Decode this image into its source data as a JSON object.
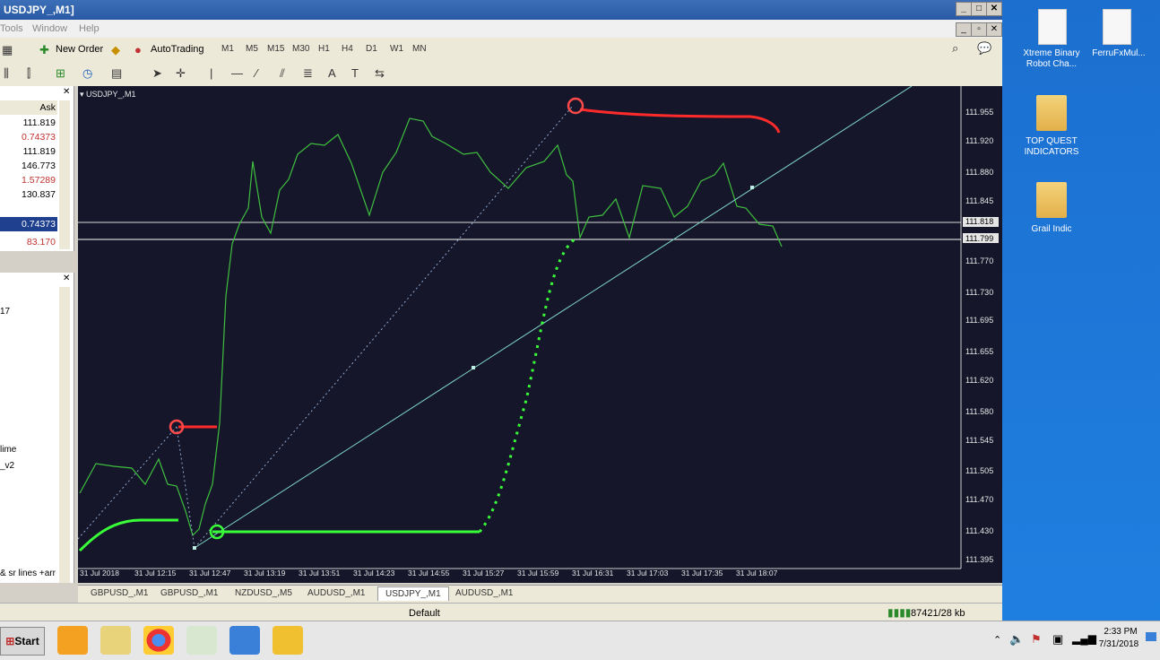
{
  "window": {
    "title": "USDJPY_,M1]"
  },
  "menu": {
    "tools": "Tools",
    "window": "Window",
    "help": "Help"
  },
  "toolbar": {
    "new_order": "New Order",
    "autotrading": "AutoTrading",
    "timeframes": [
      "M1",
      "M5",
      "M15",
      "M30",
      "H1",
      "H4",
      "D1",
      "W1",
      "MN"
    ]
  },
  "market_watch": {
    "ask_header": "Ask",
    "values": [
      "111.819",
      "0.74373",
      "111.819",
      "146.773",
      "1.57289",
      "130.837",
      "0.74373",
      "83.170"
    ]
  },
  "navigator": {
    "item1": "17",
    "item2": "lime",
    "item3": "_v2",
    "item4": "& sr lines +arr"
  },
  "chart": {
    "symbol": "USDJPY_,M1",
    "price_ticks": [
      "111.955",
      "111.920",
      "111.880",
      "111.845",
      "111.818",
      "111.799",
      "111.770",
      "111.730",
      "111.695",
      "111.655",
      "111.620",
      "111.580",
      "111.545",
      "111.505",
      "111.470",
      "111.430",
      "111.395"
    ],
    "time_ticks": [
      "31 Jul 2018",
      "31 Jul 12:15",
      "31 Jul 12:47",
      "31 Jul 13:19",
      "31 Jul 13:51",
      "31 Jul 14:23",
      "31 Jul 14:55",
      "31 Jul 15:27",
      "31 Jul 15:59",
      "31 Jul 16:31",
      "31 Jul 17:03",
      "31 Jul 17:35",
      "31 Jul 18:07"
    ]
  },
  "tabs": [
    "GBPUSD_,M1",
    "GBPUSD_,M1",
    "NZDUSD_,M5",
    "AUDUSD_,M1",
    "USDJPY_,M1",
    "AUDUSD_,M1"
  ],
  "status": {
    "profile": "Default",
    "traffic": "87421/28 kb"
  },
  "taskbar": {
    "start": "Start",
    "time": "2:33 PM",
    "date": "7/31/2018"
  },
  "desktop": {
    "icon1": "Xtreme Binary Robot Cha...",
    "icon2": "FerruFxMul...",
    "icon3": "TOP QUEST INDICATORS",
    "icon4": "Grail Indic"
  },
  "colors": {
    "chart_bg": "#15162a",
    "candle": "#3fbf3f",
    "indicator": "#39ff39",
    "signal_sell": "#ff2b2b",
    "trendline": "#7fd6c4"
  }
}
